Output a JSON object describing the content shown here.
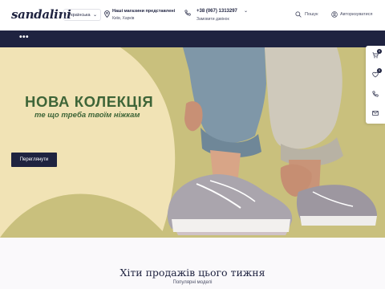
{
  "header": {
    "logo": "sandalini",
    "language": "Українська",
    "stores_title": "Наші магазини представлені",
    "stores_cities": "Київ, Харків",
    "phone": "+38 (067) 1313297",
    "callback": "Замовити дзвінок",
    "search": "Пошук",
    "auth": "Авторизуватися"
  },
  "nav": {
    "menu": "•••"
  },
  "hero": {
    "title": "НОВА КОЛЕКЦІЯ",
    "subtitle": "те що треба твоїм ніжкам",
    "button": "Переглянути"
  },
  "rail": {
    "cart_count": "0",
    "wishlist_count": "0"
  },
  "section": {
    "title": "Хіти продажів цього тижня",
    "subtitle": "Популярні моделі"
  },
  "colors": {
    "navy": "#1f2340",
    "hero_bg": "#f1e3b5",
    "hero_green": "#3e6538",
    "olive": "#c9c07d"
  }
}
